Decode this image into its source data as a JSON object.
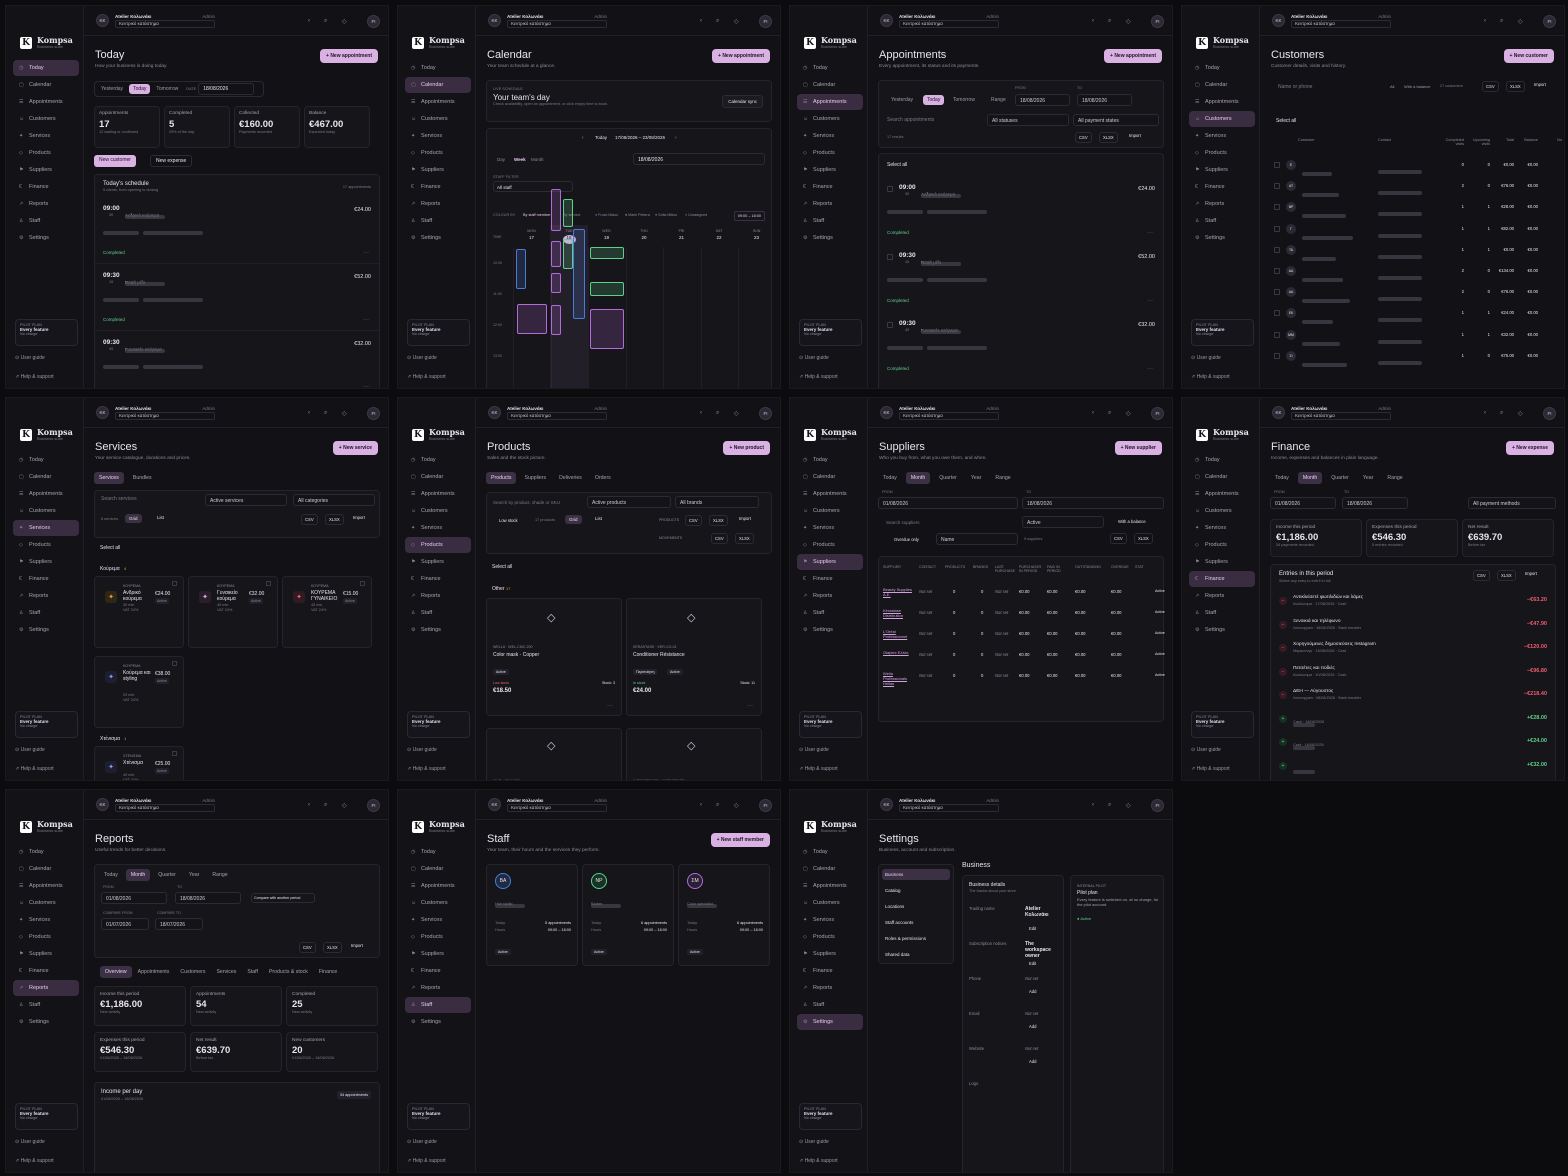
{
  "brand": {
    "name": "Kompsa",
    "tagline": "Business suite",
    "logo_letter": "K"
  },
  "workspace": {
    "name": "Atelier Κολωνάκι",
    "role": "Admin",
    "location": "Κεντρικό κατάστημα",
    "avatar": "KK"
  },
  "user_initials": "FI",
  "nav": [
    "Today",
    "Calendar",
    "Appointments",
    "Customers",
    "Services",
    "Products",
    "Suppliers",
    "Finance",
    "Reports",
    "Staff",
    "Settings"
  ],
  "pilot": {
    "title": "PILOT PLAN",
    "feature": "Every feature",
    "charge": "No charge"
  },
  "footer": {
    "guide": "User guide",
    "help": "Help & support"
  },
  "today": {
    "title": "Today",
    "subtitle": "How your business is doing today.",
    "cta": "+ New appointment",
    "range": [
      "Yesterday",
      "Today",
      "Tomorrow"
    ],
    "date_label": "DATE",
    "date": "18/08/2026",
    "kpis": [
      {
        "label": "Appointments",
        "value": "17",
        "sub": "12 waiting or confirmed"
      },
      {
        "label": "Completed",
        "value": "5",
        "sub": "29% of the day"
      },
      {
        "label": "Collected",
        "value": "€160.00",
        "sub": "Payments recorded"
      },
      {
        "label": "Balance",
        "value": "€467.00",
        "sub": "Expected today"
      }
    ],
    "new_customer": "New customer",
    "new_expense": "New expense",
    "schedule_title": "Today's schedule",
    "schedule_sub": "5 clients, from opening to closing",
    "schedule_count": "17 appointments",
    "appts": [
      {
        "time": "09:00",
        "dur": "30",
        "svc": "Ανδρικό κούρεμα",
        "price": "€24.00",
        "status": "Completed"
      },
      {
        "time": "09:30",
        "dur": "15",
        "svc": "Βαφή μέλι",
        "price": "€52.00",
        "status": "Completed"
      },
      {
        "time": "09:30",
        "dur": "45",
        "svc": "Γυναικείο κούρεμα",
        "price": "€32.00",
        "status": ""
      }
    ]
  },
  "calendar": {
    "title": "Calendar",
    "subtitle": "Your team schedule at a glance.",
    "cta": "+ New appointment",
    "live": "LIVE SCHEDULE",
    "heading": "Your team's day",
    "desc": "Check availability, open an appointment, or click empty time to book.",
    "sync": "Calendar sync",
    "today": "Today",
    "range": "17/08/2026 – 23/08/2026",
    "views": [
      "Day",
      "Week",
      "Month"
    ],
    "date": "18/08/2026",
    "staff_label": "STAFF FILTER",
    "staff": "All staff",
    "colour_by": "COLOUR BY",
    "by_staff": "By staff member",
    "by_service": "By service",
    "legend": [
      "Frosó Malou",
      "Marie Pettera",
      "Sofia Mittou",
      "Unassigned"
    ],
    "hours": "09:00 – 18:00",
    "days": [
      {
        "d": "MON",
        "n": "17"
      },
      {
        "d": "TUE",
        "n": "18"
      },
      {
        "d": "WED",
        "n": "19"
      },
      {
        "d": "THU",
        "n": "20"
      },
      {
        "d": "FRI",
        "n": "21"
      },
      {
        "d": "SAT",
        "n": "22"
      },
      {
        "d": "SUN",
        "n": "23"
      }
    ],
    "time_col": "TIME",
    "slots": [
      "10:00",
      "11:00",
      "12:00",
      "13:00"
    ]
  },
  "appointments": {
    "title": "Appointments",
    "subtitle": "Every appointment, its status and its payments.",
    "cta": "+ New appointment",
    "range": [
      "Yesterday",
      "Today",
      "Tomorrow",
      "Range"
    ],
    "from": "FROM",
    "to": "TO",
    "date_from": "18/08/2026",
    "date_to": "18/08/2026",
    "search": "Search appointments",
    "status": "All statuses",
    "payment": "All payment states",
    "results": "17 results",
    "csv": "CSV",
    "xlsx": "XLSX",
    "import": "Import",
    "select_all": "Select all",
    "rows": [
      {
        "time": "09:00",
        "dur": "30",
        "svc": "Ανδρικό κούρεμα",
        "price": "€24.00",
        "status": "Completed"
      },
      {
        "time": "09:30",
        "dur": "15",
        "svc": "Βαφή μέλι",
        "price": "€52.00",
        "status": "Completed"
      },
      {
        "time": "09:30",
        "dur": "45",
        "svc": "Γυναικείο κούρεμα",
        "price": "€32.00",
        "status": "Completed"
      }
    ]
  },
  "customers": {
    "title": "Customers",
    "subtitle": "Customer details, visits and history.",
    "cta": "+ New customer",
    "search": "Name or phone",
    "filters": [
      "All",
      "With a balance"
    ],
    "count": "27 customers",
    "select_all": "Select all",
    "cols": [
      "Customer",
      "Contact",
      "Completed visits",
      "Upcoming visits",
      "Total",
      "Balance",
      "No"
    ],
    "rows": [
      {
        "i": "E",
        "c": "0",
        "u": "0",
        "t": "€0.00",
        "b": "€0.00"
      },
      {
        "i": "AT",
        "c": "2",
        "u": "0",
        "t": "€76.00",
        "b": "€0.00"
      },
      {
        "i": "BP",
        "c": "1",
        "u": "1",
        "t": "€28.00",
        "b": "€0.00"
      },
      {
        "i": "Γ",
        "c": "1",
        "u": "1",
        "t": "€82.00",
        "b": "€0.00"
      },
      {
        "i": "TA",
        "c": "1",
        "u": "1",
        "t": "€0.00",
        "b": "€0.00"
      },
      {
        "i": "ΑΑ",
        "c": "2",
        "u": "0",
        "t": "€134.00",
        "b": "€0.00"
      },
      {
        "i": "AA",
        "c": "2",
        "u": "0",
        "t": "€76.00",
        "b": "€0.00"
      },
      {
        "i": "ΕΚ",
        "c": "1",
        "u": "1",
        "t": "€24.00",
        "b": "€0.00"
      },
      {
        "i": "ΜΜ",
        "c": "1",
        "u": "1",
        "t": "€32.00",
        "b": "€0.00"
      },
      {
        "i": "ΣΙ",
        "c": "1",
        "u": "0",
        "t": "€75.00",
        "b": "€0.00"
      }
    ]
  },
  "services": {
    "title": "Services",
    "subtitle": "Your service catalogue, durations and prices.",
    "cta": "+ New service",
    "tabs": [
      "Services",
      "Bundles"
    ],
    "search": "Search services",
    "active": "Active services",
    "cats": "All categories",
    "count": "8 services",
    "grid": "Grid",
    "list": "List",
    "select_all": "Select all",
    "group1": "Κούρεμα",
    "group1_count": "4",
    "group2": "Χτένισμα",
    "group2_count": "1",
    "items": [
      {
        "cat": "ΚΟΥΡΕΜΑ",
        "name": "Ανδρικό κούρεμα",
        "dur": "30 min",
        "vat": "VAT 24%",
        "price": "€24.00"
      },
      {
        "cat": "ΚΟΥΡΕΜΑ",
        "name": "Γυναικείο κούρεμα",
        "dur": "45 min",
        "vat": "VAT 24%",
        "price": "€32.00"
      },
      {
        "cat": "ΚΟΥΡΕΜΑ",
        "name": "ΚΟΥΡΕΜΑ ΓΥΝΑΙΚΕΙΟ",
        "dur": "45 min",
        "vat": "VAT 24%",
        "price": "€15.00"
      },
      {
        "cat": "ΚΟΥΡΕΜΑ",
        "name": "Κούρεμα και styling",
        "dur": "20 min",
        "vat": "VAT 24%",
        "price": "€38.00"
      },
      {
        "cat": "ΧΤΕΝΙΣΜΑ",
        "name": "Χτένισμα",
        "dur": "40 min",
        "vat": "VAT 24%",
        "price": "€25.00"
      }
    ],
    "active_badge": "Active"
  },
  "products": {
    "title": "Products",
    "subtitle": "Sales and the stock picture.",
    "cta": "+ New product",
    "tabs": [
      "Products",
      "Suppliers",
      "Deliveries",
      "Orders"
    ],
    "search": "Search by product, shade or SKU",
    "active": "Active products",
    "brands": "All brands",
    "low": "Low stock",
    "count": "17 products",
    "grid": "Grid",
    "list": "List",
    "prod_label": "PRODUCTS",
    "mov_label": "MOVEMENTS",
    "select_all": "Select all",
    "group": "Other",
    "group_count": "17",
    "items": [
      {
        "sku": "WELLA · WEL-CMC-200",
        "name": "Color mask · Copper",
        "badge": "Active",
        "stock_state": "Low stock",
        "stock": "Stock: 3",
        "price": "€18.50"
      },
      {
        "sku": "KÉRASTASE · KER-CO-01",
        "name": "Conditioner Résistance",
        "badge": "Active",
        "tag": "Περιποίηση",
        "stock_state": "In stock",
        "stock": "Stock: 11",
        "price": "€24.00"
      }
    ],
    "more": [
      "OLIO · 80ML800",
      "WORKSTANDS · WORKSTASE"
    ]
  },
  "suppliers": {
    "title": "Suppliers",
    "subtitle": "Who you buy from, what you owe them, and when.",
    "cta": "+ New supplier",
    "range": [
      "Today",
      "Month",
      "Quarter",
      "Year",
      "Range"
    ],
    "date_from": "01/08/2026",
    "date_to": "18/08/2026",
    "search": "Search suppliers",
    "active": "Active",
    "balance": "With a balance",
    "overdue": "Overdue only",
    "sort": "Name",
    "count": "5 suppliers",
    "cols": [
      "SUPPLIER",
      "CONTACT",
      "PRODUCTS",
      "BRANDS",
      "LAST PURCHASE",
      "PURCHASES IN PERIOD",
      "PAID IN PERIOD",
      "OUTSTANDING",
      "OVERDUE",
      "STAT"
    ],
    "rows": [
      {
        "n": "Beauty Supplies A.E."
      },
      {
        "n": "Kérastase Distribution"
      },
      {
        "n": "L'Oréal Professionnel"
      },
      {
        "n": "Olaplex Ελλάς"
      },
      {
        "n": "Wella Professionals Hellas"
      }
    ],
    "not_set": "Not set",
    "zero": "0",
    "eur": "€0.00"
  },
  "finance": {
    "title": "Finance",
    "subtitle": "Income, expenses and balances in plain language.",
    "cta": "+ New expense",
    "range": [
      "Today",
      "Month",
      "Quarter",
      "Year",
      "Range"
    ],
    "date_from": "01/08/2026",
    "date_to": "18/08/2026",
    "methods": "All payment methods",
    "kpis": [
      {
        "label": "Income this period",
        "value": "€1,186.00",
        "sub": "34 payments recorded"
      },
      {
        "label": "Expenses this period",
        "value": "€546.30",
        "sub": "5 entries recorded"
      },
      {
        "label": "Net result",
        "value": "€639.70",
        "sub": "Before tax"
      }
    ],
    "entries_title": "Entries in this period",
    "entries_sub": "Select any entry to edit it in full",
    "entries": [
      {
        "t": "Αντικλείσετέ φωτιλιδών και λάμες",
        "m": "Αναλώσιμα · 17/08/2026 · Cash",
        "a": "−€63.20",
        "neg": true
      },
      {
        "t": "Ξενοικιά και τηλέφωνο",
        "m": "Λειτουργικά · 16/08/2026 · Bank transfer",
        "a": "−€47.90",
        "neg": true
      },
      {
        "t": "Χορηγούμενες δημοσιεύσεις Instagram",
        "m": "Μάρκετινγκ · 15/08/2026 · Card",
        "a": "−€120.00",
        "neg": true
      },
      {
        "t": "Πετσέτες και ποδιές",
        "m": "Αναλώσιμα · 10/08/2026 · Cash",
        "a": "−€96.80",
        "neg": true
      },
      {
        "t": "ΔΕΗ — Αύγουστος",
        "m": "Λειτουργικά · 08/08/2026 · Bank transfer",
        "a": "−€218.40",
        "neg": true
      },
      {
        "t": "",
        "m": "Cash · 18/08/2026",
        "a": "+€28.00",
        "neg": false
      },
      {
        "t": "",
        "m": "Card · 18/08/2026",
        "a": "+€24.00",
        "neg": false
      },
      {
        "t": "",
        "m": "",
        "a": "+€32.00",
        "neg": false
      }
    ]
  },
  "reports": {
    "title": "Reports",
    "subtitle": "Useful trends for better decisions.",
    "range": [
      "Today",
      "Month",
      "Quarter",
      "Year",
      "Range"
    ],
    "from": "FROM",
    "to": "TO",
    "date_from": "01/08/2026",
    "date_to": "18/08/2026",
    "compare": "Compare with another period",
    "cmp_from_l": "COMPARE FROM",
    "cmp_to_l": "COMPARE TO",
    "cmp_from": "01/07/2026",
    "cmp_to": "18/07/2026",
    "tabs": [
      "Overview",
      "Appointments",
      "Customers",
      "Services",
      "Staff",
      "Products & stock",
      "Finance"
    ],
    "kpis": [
      {
        "label": "Income this period",
        "value": "€1,186.00",
        "sub": "New activity"
      },
      {
        "label": "Appointments",
        "value": "54",
        "sub": "New activity"
      },
      {
        "label": "Completed",
        "value": "25",
        "sub": "New activity"
      },
      {
        "label": "Expenses this period",
        "value": "€546.30",
        "sub": "01/08/2026 – 18/08/2026"
      },
      {
        "label": "Net result",
        "value": "€639.70",
        "sub": "Before tax"
      },
      {
        "label": "New customers",
        "value": "20",
        "sub": "01/08/2026 – 18/08/2026"
      }
    ],
    "income_day": "Income per day",
    "income_day_sub": "01/08/2026 – 18/08/2026",
    "income_day_badge": "34 appointments"
  },
  "staff": {
    "title": "Staff",
    "subtitle": "Your team, their hours and the services they perform.",
    "cta": "+ New staff member",
    "members": [
      {
        "i": "ΒΑ",
        "role": "Hair stylist",
        "today_n": "5 appointments",
        "hours": "09:00 – 18:00",
        "st": "Active"
      },
      {
        "i": "NP",
        "role": "Barber",
        "today_n": "6 appointments",
        "hours": "09:00 – 18:00",
        "st": "Active"
      },
      {
        "i": "ΣΜ",
        "role": "Color specialist",
        "today_n": "6 appointments",
        "hours": "09:00 – 18:00",
        "st": "Active"
      }
    ],
    "today_l": "Today",
    "hours_l": "Hours"
  },
  "settings": {
    "title": "Settings",
    "subtitle": "Business, account and subscription.",
    "menu": [
      "Business",
      "Catalog",
      "Locations",
      "Staff accounts",
      "Roles & permissions",
      "Shared data"
    ],
    "section": "Business",
    "details": "Business details",
    "details_sub": "The basics about your store",
    "fields": [
      {
        "l": "Trading name",
        "v": "Atelier Κολωνάκι",
        "a": "Edit"
      },
      {
        "l": "Subscription notices",
        "v": "The workspace owner",
        "a": "Edit"
      },
      {
        "l": "Phone",
        "v": "Not set",
        "a": "Add"
      },
      {
        "l": "Email",
        "v": "Not set",
        "a": "Add"
      },
      {
        "l": "Website",
        "v": "Not set",
        "a": "Add"
      },
      {
        "l": "Logo",
        "v": "",
        "a": ""
      }
    ],
    "pilot_tag": "INTERNAL PILOT",
    "pilot_plan": "Pilot plan",
    "pilot_desc": "Every feature is switched on, at no charge, for the pilot account.",
    "pilot_status": "Active"
  },
  "colors": {
    "accent": "#d9b1e3",
    "bg": "#121116",
    "green": "#5fd08b",
    "red": "#ef5d73"
  }
}
